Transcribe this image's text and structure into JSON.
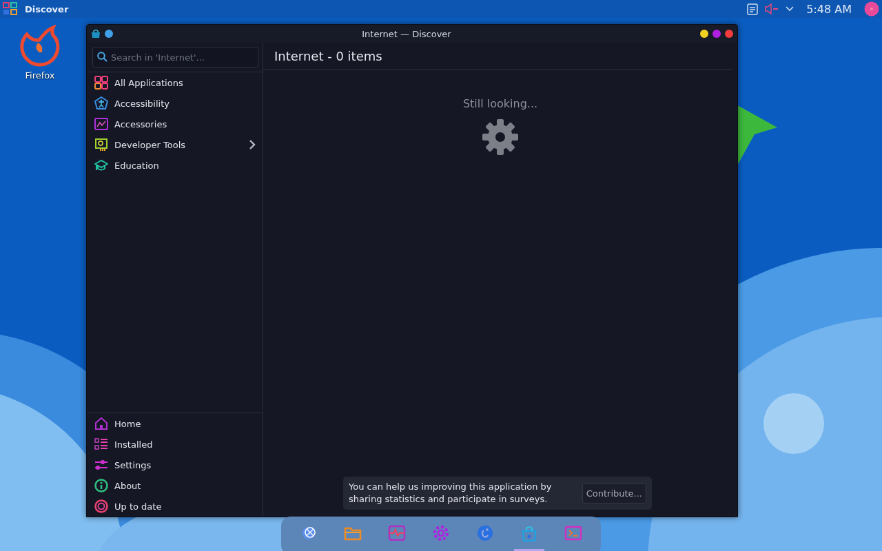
{
  "top_panel": {
    "app_title": "Discover",
    "clock": "5:48 AM",
    "volume_muted": true
  },
  "desktop_icons": [
    {
      "label": "Firefox"
    }
  ],
  "window": {
    "title": "Internet — Discover",
    "search": {
      "placeholder": "Search in 'Internet'..."
    },
    "categories": [
      {
        "label": "All Applications",
        "submenu": false
      },
      {
        "label": "Accessibility",
        "submenu": false
      },
      {
        "label": "Accessories",
        "submenu": false
      },
      {
        "label": "Developer Tools",
        "submenu": true
      },
      {
        "label": "Education",
        "submenu": false
      }
    ],
    "nav": [
      {
        "label": "Home"
      },
      {
        "label": "Installed"
      },
      {
        "label": "Settings"
      },
      {
        "label": "About"
      },
      {
        "label": "Up to date"
      }
    ],
    "header": "Internet - 0 items",
    "status": "Still looking...",
    "notice": {
      "text": "You can help us improving this application by sharing statistics and participate in surveys.",
      "button": "Contribute..."
    }
  },
  "dock": [
    {
      "selected": false
    },
    {
      "selected": false
    },
    {
      "selected": false
    },
    {
      "selected": false
    },
    {
      "selected": false
    },
    {
      "selected": true
    },
    {
      "selected": false
    }
  ]
}
